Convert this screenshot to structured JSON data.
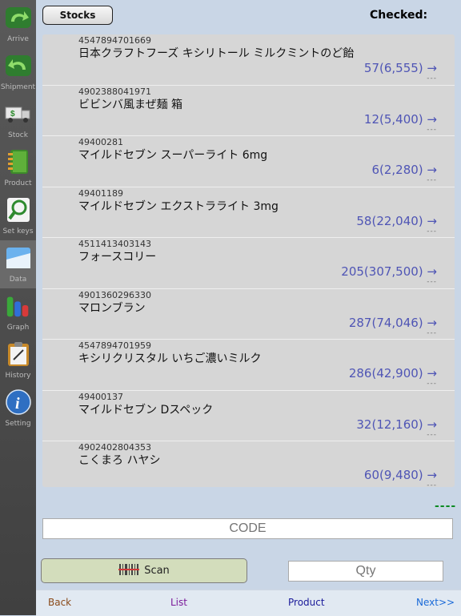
{
  "sidebar": {
    "items": [
      {
        "label": "Arrive",
        "icon": "arrive-arrow-icon",
        "color": "#3b9a3b"
      },
      {
        "label": "Shipment",
        "icon": "shipment-arrow-icon",
        "color": "#3b9a3b"
      },
      {
        "label": "Stock",
        "icon": "truck-icon",
        "color": "#3b9a3b"
      },
      {
        "label": "Product",
        "icon": "notebook-icon",
        "color": "#3b9a3b"
      },
      {
        "label": "Set keys",
        "icon": "magnifier-icon",
        "color": "#3b9a3b"
      },
      {
        "label": "Data",
        "icon": "data-panel-icon",
        "color": "#3a8fd8"
      },
      {
        "label": "Graph",
        "icon": "bar-graph-icon",
        "color": "#3b9a3b"
      },
      {
        "label": "History",
        "icon": "clipboard-icon",
        "color": "#d8a23a"
      },
      {
        "label": "Setting",
        "icon": "info-icon",
        "color": "#2f6fc2"
      }
    ],
    "active": "Data"
  },
  "header": {
    "stocks_button": "Stocks",
    "checked_label": "Checked:"
  },
  "list": {
    "rows": [
      {
        "code": "4547894701669",
        "name": "日本クラフトフーズ キシリトール ミルクミントのど飴",
        "qty": "57(6,555) →",
        "dash": "---"
      },
      {
        "code": "4902388041971",
        "name": "ビビンバ風まぜ麺 箱",
        "qty": "12(5,400) →",
        "dash": "---"
      },
      {
        "code": "49400281",
        "name": "マイルドセブン スーパーライト 6mg",
        "qty": "6(2,280) →",
        "dash": "---"
      },
      {
        "code": "49401189",
        "name": "マイルドセブン エクストラライト 3mg",
        "qty": "58(22,040) →",
        "dash": "---"
      },
      {
        "code": "4511413403143",
        "name": "フォースコリー",
        "qty": "205(307,500) →",
        "dash": "---"
      },
      {
        "code": "4901360296330",
        "name": "マロンブラン",
        "qty": "287(74,046) →",
        "dash": "---"
      },
      {
        "code": "4547894701959",
        "name": "キシリクリスタル いちご濃いミルク",
        "qty": "286(42,900) →",
        "dash": "---"
      },
      {
        "code": "49400137",
        "name": "マイルドセブン Dスペック",
        "qty": "32(12,160) →",
        "dash": "---"
      },
      {
        "code": "4902402804353",
        "name": "こくまろ ハヤシ",
        "qty": "60(9,480) →",
        "dash": "---"
      }
    ]
  },
  "status": {
    "dash": "----",
    "color": "#0a8a22"
  },
  "input": {
    "code_placeholder": "CODE",
    "qty_placeholder": "Qty"
  },
  "scan": {
    "label": "Scan",
    "icon": "barcode-icon"
  },
  "bottom_nav": [
    {
      "label": "Back",
      "color": "#8a4a1a"
    },
    {
      "label": "List",
      "color": "#7a1a9a"
    },
    {
      "label": "Product",
      "color": "#1a1a9a"
    },
    {
      "label": "Next>>",
      "color": "#1a6ad8"
    }
  ]
}
